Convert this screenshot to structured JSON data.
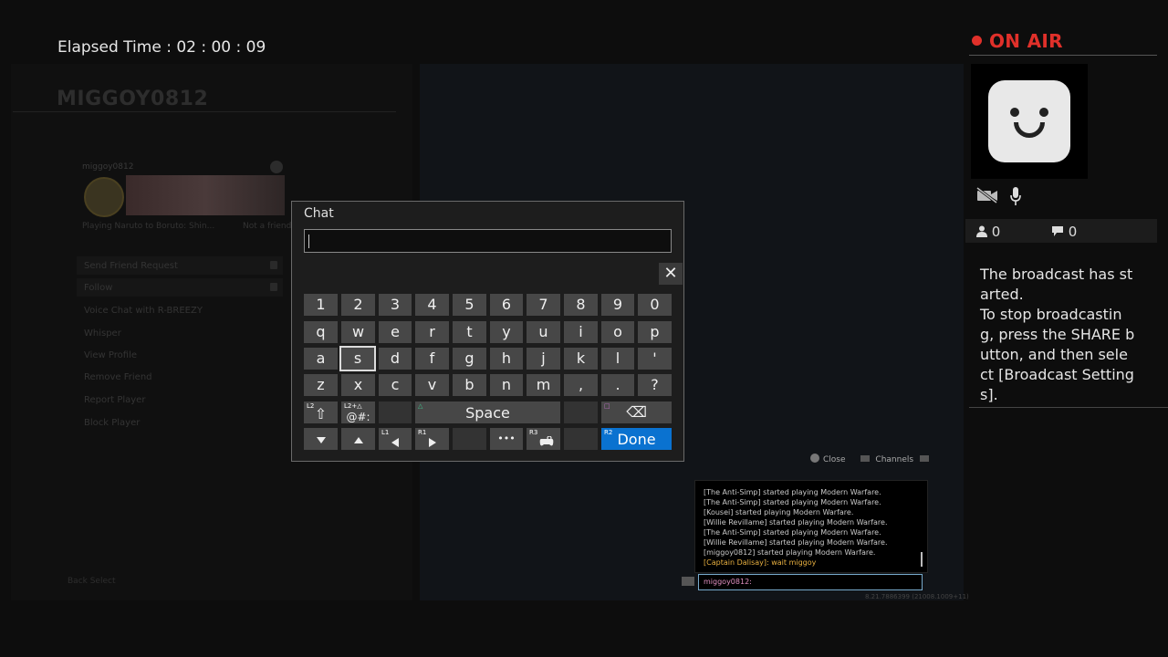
{
  "elapsed": {
    "label": "Elapsed Time :",
    "value": "02 : 00 : 09"
  },
  "background": {
    "profile_name": "MIGGOY0812",
    "card_user": "miggoy0812",
    "card_status": "Playing Naruto to Boruto: Shin...",
    "card_friend": "Not a friend",
    "menu": [
      "Send Friend Request",
      "Follow",
      "Voice Chat with R-BREEZY",
      "Whisper",
      "View Profile",
      "Remove Friend",
      "Report Player",
      "Block Player"
    ],
    "bottom_hints": "Back   Select"
  },
  "onair": {
    "label": "ON AIR",
    "viewers": "0",
    "comments": "0",
    "message": "The broadcast has started.\nTo stop broadcasting, press the SHARE button, and then select [Broadcast Settings]."
  },
  "chat_panel": {
    "close_label": "Close",
    "channels_label": "Channels",
    "log": [
      {
        "text": "[The Anti-Simp] started playing Modern Warfare.",
        "color": "#c8c8c8"
      },
      {
        "text": "[The Anti-Simp] started playing Modern Warfare.",
        "color": "#c8c8c8"
      },
      {
        "text": "[Kousei] started playing Modern Warfare.",
        "color": "#c8c8c8"
      },
      {
        "text": "[Willie Revillame] started playing Modern Warfare.",
        "color": "#c8c8c8"
      },
      {
        "text": "[The Anti-Simp] started playing Modern Warfare.",
        "color": "#c8c8c8"
      },
      {
        "text": "[Willie Revillame] started playing Modern Warfare.",
        "color": "#c8c8c8"
      },
      {
        "text": "[miggoy0812] started playing Modern Warfare.",
        "color": "#c8c8c8"
      },
      {
        "text": "[Captain Dalisay]: wait miggoy",
        "color": "#e8b040"
      }
    ],
    "compose_prefix": "miggoy0812:",
    "version": "8.21.7886399 (21008.1009+11)"
  },
  "keyboard": {
    "title": "Chat",
    "input_value": "",
    "close_glyph": "✕",
    "row_digits": [
      "1",
      "2",
      "3",
      "4",
      "5",
      "6",
      "7",
      "8",
      "9",
      "0"
    ],
    "row1": [
      "q",
      "w",
      "e",
      "r",
      "t",
      "y",
      "u",
      "i",
      "o",
      "p"
    ],
    "row2": [
      "a",
      "s",
      "d",
      "f",
      "g",
      "h",
      "j",
      "k",
      "l",
      "'"
    ],
    "row3": [
      "z",
      "x",
      "c",
      "v",
      "b",
      "n",
      "m",
      ",",
      ".",
      "?"
    ],
    "selected_key": "s",
    "func": {
      "shift_tag": "L2",
      "shift_glyph": "⇧",
      "symbols_tag": "L2+△",
      "symbols_label": "@#:",
      "space_label": "Space",
      "backspace_glyph": "⌫",
      "left_tag": "L1",
      "right_tag": "R1",
      "gamepad_tag": "R3",
      "more_label": "•••",
      "done_tag": "R2",
      "done_label": "Done",
      "triangle": "△",
      "square": "□"
    }
  },
  "colors": {
    "accent": "#e0302a",
    "done": "#0a72d0"
  }
}
